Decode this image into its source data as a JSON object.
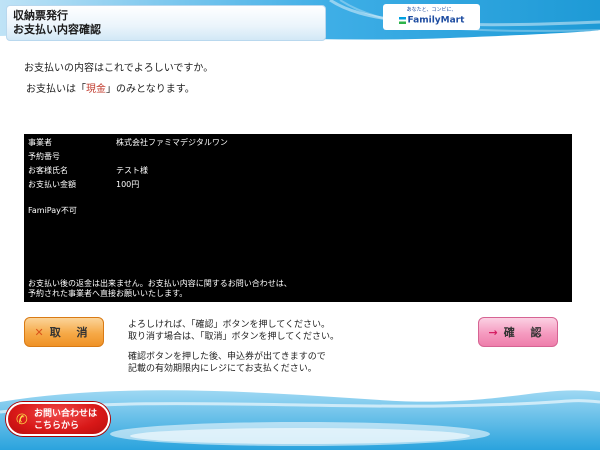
{
  "header": {
    "title_line1": "収納票発行",
    "title_line2": "お支払い内容確認",
    "brand_tagline": "あなたと、コンビに、",
    "brand_name": "FamilyMart"
  },
  "messages": {
    "confirm_question": "お支払いの内容はこれでよろしいですか。",
    "cash_prefix": "お支払いは「",
    "cash_word": "現金",
    "cash_suffix": "」のみとなります。"
  },
  "details": {
    "rows": [
      {
        "label": "事業者",
        "value": "株式会社ファミマデジタルワン"
      },
      {
        "label": "予約番号",
        "value": ""
      },
      {
        "label": "お客様氏名",
        "value": "テスト様"
      },
      {
        "label": "お支払い金額",
        "value": "100円"
      }
    ],
    "famipay_note": "FamiPay不可",
    "notice_line1": "お支払い後の返金は出来ません。お支払い内容に関するお問い合わせは、",
    "notice_line2": "予約された事業者へ直接お願いいたします。"
  },
  "buttons": {
    "cancel_label": "取 消",
    "confirm_label": "確 認"
  },
  "instructions": {
    "line1": "よろしければ、「確認」ボタンを押してください。",
    "line2": "取り消す場合は、「取消」ボタンを押してください。",
    "line3": "確認ボタンを押した後、申込券が出てきますので",
    "line4": "記載の有効期限内にレジにてお支払ください。"
  },
  "inquiry": {
    "line1": "お問い合わせは",
    "line2": "こちらから"
  },
  "colors": {
    "cancel_button": "#f6a947",
    "confirm_button": "#f59bc0",
    "cash_highlight": "#c0392b",
    "panel_background": "#000000",
    "inquiry_button": "#d81818",
    "header_blue": "#1e9ad6"
  },
  "icons": {
    "cancel": "x-icon",
    "confirm": "arrow-right-icon",
    "inquiry": "phone-icon"
  }
}
